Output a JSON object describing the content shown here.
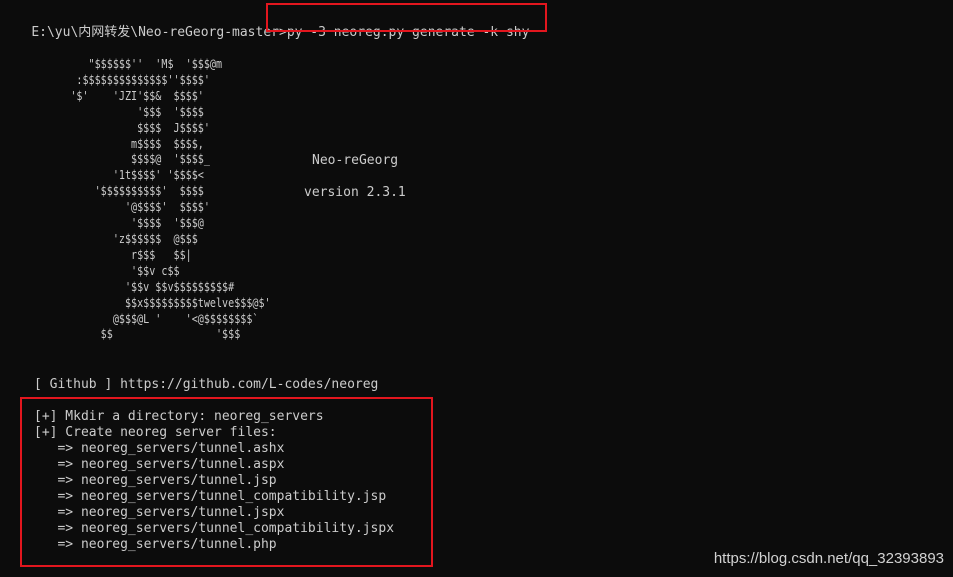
{
  "prompt": {
    "path": "E:\\yu\\内网转发\\Neo-reGeorg-master>",
    "command": "py -3 neoreg.py generate -k shy"
  },
  "banner": {
    "ascii_art": "        \"$$$$$$''  'M$  '$$$@m\n      :$$$$$$$$$$$$$$''$$$$'\n     '$'    'JZI'$$&  $$$$'\n                '$$$  '$$$$\n                $$$$  J$$$$'\n               m$$$$  $$$$,\n               $$$$@  '$$$$_\n            '1t$$$$' '$$$$<\n         '$$$$$$$$$$'  $$$$\n              '@$$$$'  $$$$'\n               '$$$$  '$$$@\n            'z$$$$$$  @$$$\n               r$$$   $$|\n               '$$v c$$\n              '$$v $$v$$$$$$$$$#\n              $$x$$$$$$$$$twelve$$$@$'\n            @$$$@L '    '<@$$$$$$$$`\n          $$                 '$$$",
    "name": "Neo-reGeorg",
    "version": "version 2.3.1"
  },
  "github_line": "[ Github ] https://github.com/L-codes/neoreg",
  "output_lines": [
    "[+] Mkdir a directory: neoreg_servers",
    "[+] Create neoreg server files:",
    "   => neoreg_servers/tunnel.ashx",
    "   => neoreg_servers/tunnel.aspx",
    "   => neoreg_servers/tunnel.jsp",
    "   => neoreg_servers/tunnel_compatibility.jsp",
    "   => neoreg_servers/tunnel.jspx",
    "   => neoreg_servers/tunnel_compatibility.jspx",
    "   => neoreg_servers/tunnel.php"
  ],
  "watermark": "https://blog.csdn.net/qq_32393893",
  "colors": {
    "background": "#0c0c0c",
    "text": "#cccccc",
    "highlight_box": "#e3161e"
  }
}
